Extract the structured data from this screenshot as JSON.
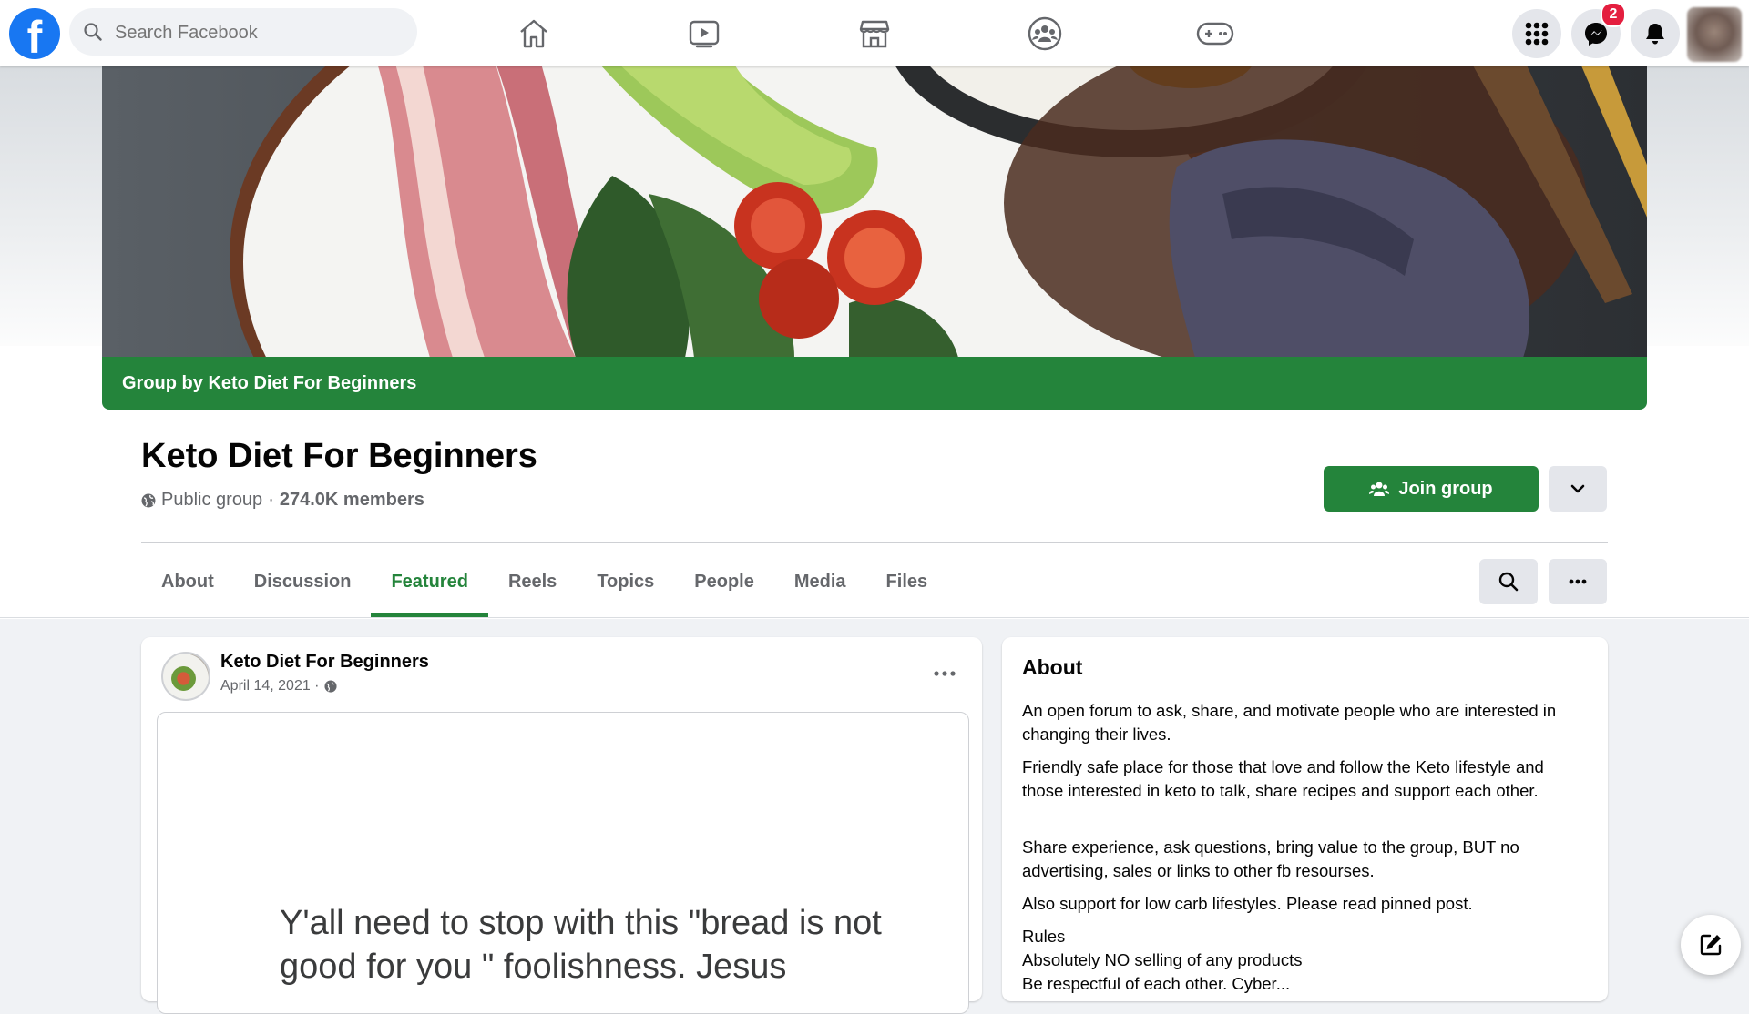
{
  "header": {
    "logo_letter": "f",
    "search_placeholder": "Search Facebook",
    "nav_icons": [
      "home-icon",
      "watch-icon",
      "marketplace-icon",
      "groups-icon",
      "gaming-icon"
    ],
    "messenger_badge": "2"
  },
  "cover": {
    "label": "Group by Keto Diet For Beginners"
  },
  "group": {
    "name": "Keto Diet For Beginners",
    "privacy": "Public group",
    "separator": " · ",
    "members": "274.0K members",
    "join_label": "Join group"
  },
  "tabs": [
    {
      "label": "About",
      "active": false
    },
    {
      "label": "Discussion",
      "active": false
    },
    {
      "label": "Featured",
      "active": true
    },
    {
      "label": "Reels",
      "active": false
    },
    {
      "label": "Topics",
      "active": false
    },
    {
      "label": "People",
      "active": false
    },
    {
      "label": "Media",
      "active": false
    },
    {
      "label": "Files",
      "active": false
    }
  ],
  "post": {
    "author": "Keto Diet For Beginners",
    "date": "April 14, 2021 ·",
    "image_text": "Y'all need to stop with this \"bread is not good for you \" foolishness. Jesus"
  },
  "about": {
    "title": "About",
    "paragraphs": [
      "An open forum to ask, share, and motivate people who are interested in changing their lives.",
      "Friendly safe place for those that love and follow the Keto lifestyle and those interested in keto to talk, share recipes and support each other.",
      "Share experience, ask questions, bring value to the group, BUT no advertising, sales or links to other fb resourses.",
      "Also support for low carb lifestyles. Please read pinned post."
    ],
    "rules_title": "Rules",
    "rules_first": "Absolutely NO selling of any products",
    "rules_second": "Be respectful of each other. Cyber..."
  },
  "colors": {
    "brand_green": "#24843b",
    "facebook_blue": "#1877f2",
    "badge_red": "#e41e3f"
  }
}
